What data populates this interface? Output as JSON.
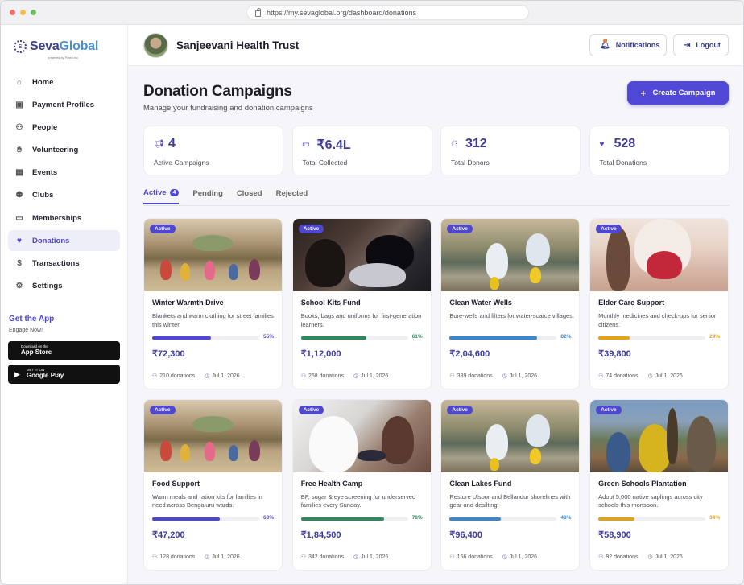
{
  "browser": {
    "url": "https://my.sevaglobal.org/dashboard/donations"
  },
  "brand": {
    "name_part1": "Seva",
    "name_part2": "Global",
    "tagline": "powered by Fixed Inc"
  },
  "sidebar": {
    "items": [
      {
        "label": "Home",
        "icon": "home-icon"
      },
      {
        "label": "Payment Profiles",
        "icon": "wallet-icon"
      },
      {
        "label": "People",
        "icon": "people-icon"
      },
      {
        "label": "Volunteering",
        "icon": "hand-icon"
      },
      {
        "label": "Events",
        "icon": "calendar-icon"
      },
      {
        "label": "Clubs",
        "icon": "group-icon"
      },
      {
        "label": "Memberships",
        "icon": "monitor-icon"
      },
      {
        "label": "Donations",
        "icon": "heart-icon",
        "active": true
      },
      {
        "label": "Transactions",
        "icon": "currency-icon"
      },
      {
        "label": "Settings",
        "icon": "gear-icon"
      }
    ],
    "get_app": "Get the App",
    "engage": "Engage Now!",
    "app_store": {
      "small": "Download on the",
      "big": "App Store"
    },
    "google_play": {
      "small": "GET IT ON",
      "big": "Google Play"
    }
  },
  "header": {
    "org_name": "Sanjeevani Health Trust",
    "notifications_label": "Notifications",
    "logout_label": "Logout"
  },
  "page": {
    "title": "Donation Campaigns",
    "subtitle": "Manage your fundraising and donation campaigns",
    "create_label": "Create Campaign"
  },
  "stats": [
    {
      "value": "4",
      "label": "Active Campaigns",
      "icon": "megaphone-icon"
    },
    {
      "value": "₹6.4L",
      "label": "Total Collected",
      "icon": "money-icon"
    },
    {
      "value": "312",
      "label": "Total Donors",
      "icon": "donors-icon"
    },
    {
      "value": "528",
      "label": "Total Donations",
      "icon": "heart-icon"
    }
  ],
  "tabs": [
    {
      "label": "Active",
      "count": "4",
      "active": true
    },
    {
      "label": "Pending"
    },
    {
      "label": "Closed"
    },
    {
      "label": "Rejected"
    }
  ],
  "campaigns": [
    {
      "badge": "Active",
      "title": "Winter Warmth Drive",
      "desc": "Blankets and warm clothing for street families this winter.",
      "progress": 55,
      "pct": "55%",
      "amount": "₹72,300",
      "donations": "210 donations",
      "date": "Jul 1, 2026",
      "color": "#4e47cf",
      "image": "village"
    },
    {
      "badge": "Active",
      "title": "School Kits Fund",
      "desc": "Books, bags and uniforms for first-generation learners.",
      "progress": 61,
      "pct": "61%",
      "amount": "₹1,12,000",
      "donations": "268 donations",
      "date": "Jul 1, 2026",
      "color": "#2e8a5c",
      "image": "laptop"
    },
    {
      "badge": "Active",
      "title": "Clean Water Wells",
      "desc": "Bore-wells and filters for water-scarce villages.",
      "progress": 82,
      "pct": "82%",
      "amount": "₹2,04,600",
      "donations": "389 donations",
      "date": "Jul 1, 2026",
      "color": "#3a86cf",
      "image": "water"
    },
    {
      "badge": "Active",
      "title": "Elder Care Support",
      "desc": "Monthly medicines and check-ups for senior citizens.",
      "progress": 29,
      "pct": "29%",
      "amount": "₹39,800",
      "donations": "74 donations",
      "date": "Jul 1, 2026",
      "color": "#e0a414",
      "image": "doctor"
    },
    {
      "badge": "Active",
      "title": "Food Support",
      "desc": "Warm meals and ration kits for families in need across Bengaluru wards.",
      "progress": 63,
      "pct": "63%",
      "amount": "₹47,200",
      "donations": "128 donations",
      "date": "Jul 1, 2026",
      "color": "#4e47cf",
      "image": "village"
    },
    {
      "badge": "Active",
      "title": "Free Health Camp",
      "desc": "BP, sugar & eye screening for underserved families every Sunday.",
      "progress": 78,
      "pct": "78%",
      "amount": "₹1,84,500",
      "donations": "342 donations",
      "date": "Jul 1, 2026",
      "color": "#2e8a5c",
      "image": "clinic"
    },
    {
      "badge": "Active",
      "title": "Clean Lakes Fund",
      "desc": "Restore Ulsoor and Bellandur shorelines with gear and desilting.",
      "progress": 48,
      "pct": "48%",
      "amount": "₹96,400",
      "donations": "156 donations",
      "date": "Jul 1, 2026",
      "color": "#3a86cf",
      "image": "water"
    },
    {
      "badge": "Active",
      "title": "Green Schools Plantation",
      "desc": "Adopt 5,000 native saplings across city schools this monsoon.",
      "progress": 34,
      "pct": "34%",
      "amount": "₹58,900",
      "donations": "92 donations",
      "date": "Jul 1, 2026",
      "color": "#e0a414",
      "image": "tree"
    }
  ]
}
